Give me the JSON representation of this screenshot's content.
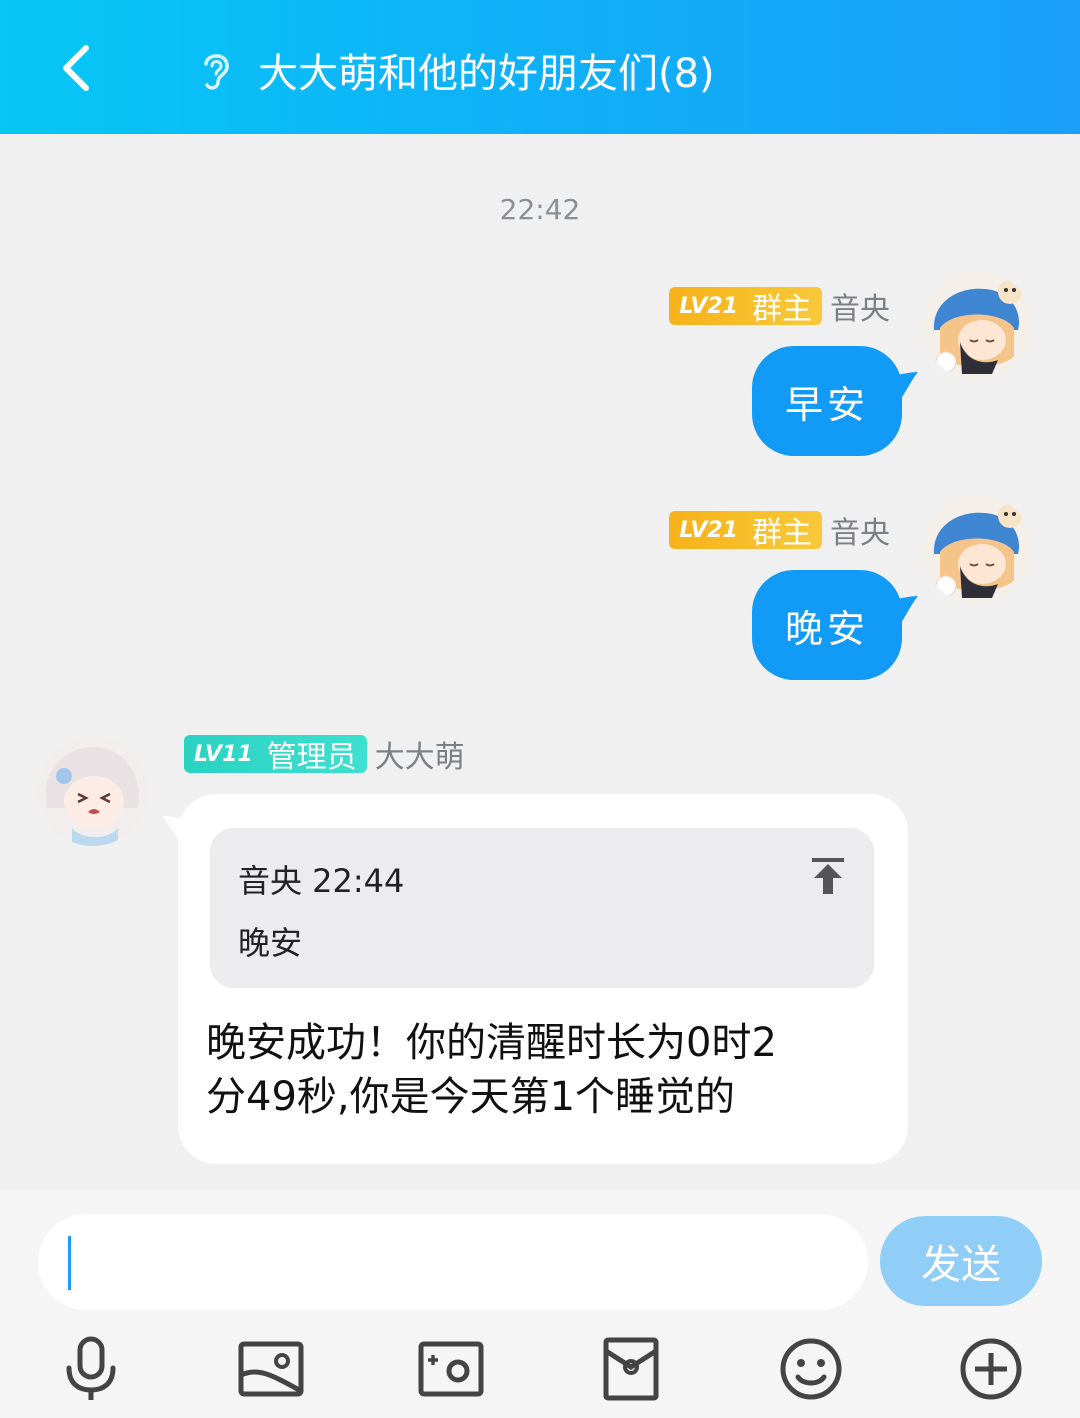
{
  "header": {
    "title": "大大萌和他的好朋友们(8)",
    "back_icon": "chevron-left-icon",
    "ear_icon": "ear-icon",
    "background": "#10b0f8"
  },
  "timestamp": "22:42",
  "messages": [
    {
      "side": "right",
      "level": "LV21",
      "role": "群主",
      "sender": "音央",
      "text": "早安",
      "badge_color": "#f7b21a",
      "bubble_color": "#129bf6"
    },
    {
      "side": "right",
      "level": "LV21",
      "role": "群主",
      "sender": "音央",
      "text": "晚安",
      "badge_color": "#f7b21a",
      "bubble_color": "#129bf6"
    },
    {
      "side": "left",
      "level": "LV11",
      "role": "管理员",
      "sender": "大大萌",
      "quote": {
        "head": "音央 22:44",
        "body": "晚安"
      },
      "reply_line1": "晚安成功！你的清醒时长为0时2",
      "reply_line2": "分49秒,你是今天第1个睡觉的",
      "badge_color": "#2ad2c2"
    }
  ],
  "input": {
    "value": "",
    "send_label": "发送",
    "send_color": "#90cdf7"
  },
  "toolbar": [
    "microphone-icon",
    "image-icon",
    "camera-icon",
    "red-packet-icon",
    "emoji-icon",
    "plus-icon"
  ]
}
